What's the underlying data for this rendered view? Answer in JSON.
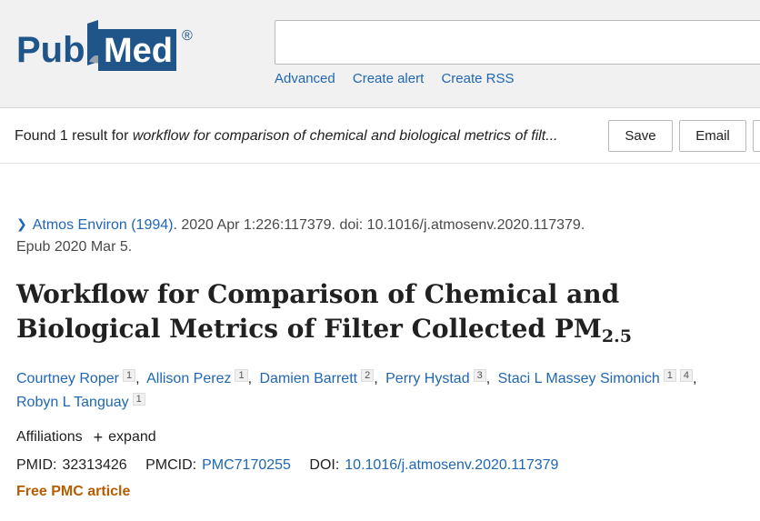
{
  "logo": {
    "text_pub": "Pub",
    "text_med": "Med",
    "registered": "®"
  },
  "search": {
    "value": "",
    "placeholder": ""
  },
  "search_links": [
    "Advanced",
    "Create alert",
    "Create RSS"
  ],
  "results": {
    "prefix": "Found 1 result for ",
    "query": "workflow for comparison of chemical and biological metrics of filt..."
  },
  "toolbar": {
    "save_label": "Save",
    "email_label": "Email"
  },
  "citation": {
    "journal": "Atmos Environ (1994)",
    "details": ". 2020 Apr 1:226:117379. doi: 10.1016/j.atmosenv.2020.117379.",
    "epub": "Epub 2020 Mar 5."
  },
  "article": {
    "title_main": "Workflow for Comparison of Chemical and Biological Metrics of Filter Collected PM",
    "title_sub": "2.5"
  },
  "authors": [
    {
      "name": "Courtney Roper",
      "affs": [
        "1"
      ]
    },
    {
      "name": "Allison Perez",
      "affs": [
        "1"
      ]
    },
    {
      "name": "Damien Barrett",
      "affs": [
        "2"
      ]
    },
    {
      "name": "Perry Hystad",
      "affs": [
        "3"
      ]
    },
    {
      "name": "Staci L Massey Simonich",
      "affs": [
        "1",
        "4"
      ]
    },
    {
      "name": "Robyn L Tanguay",
      "affs": [
        "1"
      ]
    }
  ],
  "affiliations": {
    "label": "Affiliations",
    "expand_label": "expand",
    "expand_icon": "plus-icon"
  },
  "identifiers": {
    "pmid_label": "PMID:",
    "pmid": "32313426",
    "pmcid_label": "PMCID:",
    "pmcid": "PMC7170255",
    "doi_label": "DOI:",
    "doi": "10.1016/j.atmosenv.2020.117379"
  },
  "free_pmc": "Free PMC article",
  "colors": {
    "link": "#2067b3",
    "free_pmc": "#b85c00",
    "logo_blue": "#20558a"
  }
}
